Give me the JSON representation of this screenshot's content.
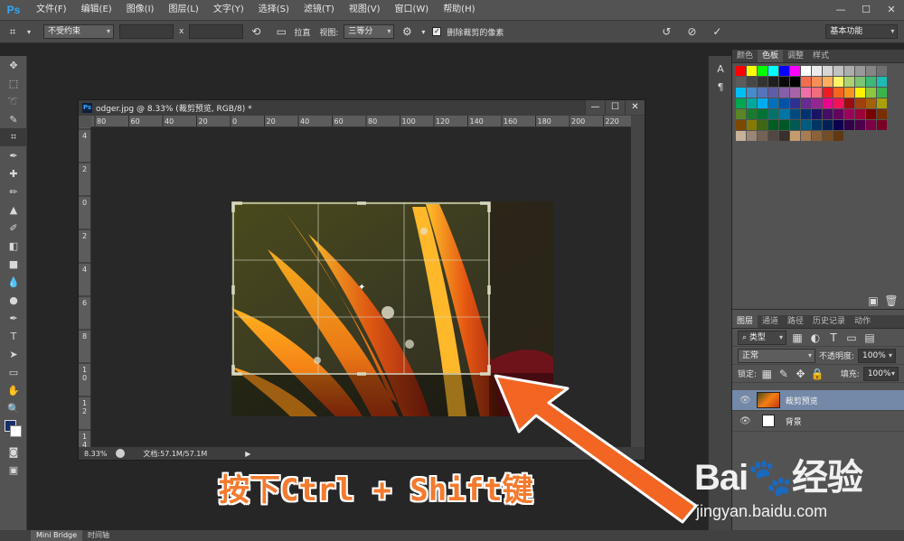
{
  "menubar": {
    "logo": "Ps",
    "items": [
      "文件(F)",
      "编辑(E)",
      "图像(I)",
      "图层(L)",
      "文字(Y)",
      "选择(S)",
      "滤镜(T)",
      "视图(V)",
      "窗口(W)",
      "帮助(H)"
    ],
    "window_buttons": [
      "—",
      "☐",
      "✕"
    ]
  },
  "options": {
    "ratio": "不受约束",
    "x_label": "x",
    "straighten": "拉直",
    "view_label": "视图:",
    "view_value": "三等分",
    "delete_pixels": "删除裁剪的像素",
    "workspace": "基本功能"
  },
  "doc": {
    "title": "odger.jpg @ 8.33% (裁剪预览, RGB/8) *",
    "ruler_top": [
      "80",
      "60",
      "40",
      "20",
      "0",
      "20",
      "40",
      "60",
      "80",
      "100",
      "120",
      "140",
      "160",
      "180",
      "200",
      "220"
    ],
    "ruler_left": [
      "4",
      "2",
      "0",
      "2",
      "4",
      "6",
      "8",
      "1 0",
      "1 2",
      "1 4"
    ],
    "zoom": "8.33%",
    "docsize": "文档:57.1M/57.1M"
  },
  "panels": {
    "swatch_tabs": [
      "颜色",
      "色板",
      "调整",
      "样式"
    ],
    "swatch_colors": [
      "#ff0000",
      "#ffff00",
      "#00ff00",
      "#00ffff",
      "#0000ff",
      "#ff00ff",
      "#ffffff",
      "#ebebeb",
      "#d6d6d6",
      "#c2c2c2",
      "#adadad",
      "#999999",
      "#858585",
      "#707070",
      "#5c5c5c",
      "#474747",
      "#333333",
      "#1f1f1f",
      "#0a0a0a",
      "#000000",
      "#f26c4f",
      "#f68e56",
      "#fbaf5c",
      "#fff467",
      "#acd372",
      "#7dc473",
      "#3cb878",
      "#1cbbb4",
      "#00bff3",
      "#448ccb",
      "#5574b9",
      "#605ca8",
      "#855fa8",
      "#a864a8",
      "#f06eaa",
      "#f26d7d",
      "#ed1c24",
      "#f26522",
      "#f7941d",
      "#fff200",
      "#8dc63f",
      "#39b54a",
      "#00a651",
      "#00a99d",
      "#00aeef",
      "#0072bc",
      "#0054a6",
      "#2e3192",
      "#662d91",
      "#92278f",
      "#ec008c",
      "#ed145b",
      "#9e0b0f",
      "#a0410d",
      "#a3620a",
      "#aba000",
      "#598527",
      "#197b30",
      "#007236",
      "#00746b",
      "#0076a3",
      "#004a80",
      "#003471",
      "#1b1464",
      "#440e62",
      "#630460",
      "#9e005d",
      "#9e0039",
      "#790000",
      "#7b2e00",
      "#7d4900",
      "#827b00",
      "#406618",
      "#005e20",
      "#005826",
      "#005952",
      "#005b7f",
      "#003663",
      "#002157",
      "#0d004c",
      "#32004b",
      "#4b0049",
      "#7b0046",
      "#7a0026",
      "#c7b299",
      "#998675",
      "#736357",
      "#534741",
      "#37302d",
      "#c69c6d",
      "#a67c52",
      "#8c6239",
      "#754c24",
      "#603913"
    ],
    "layer_tabs": [
      "图层",
      "通道",
      "路径",
      "历史记录",
      "动作"
    ],
    "kind": "类型",
    "blend_mode": "正常",
    "opacity_label": "不透明度:",
    "opacity_value": "100%",
    "lock_label": "锁定:",
    "fill_label": "填充:",
    "fill_value": "100%",
    "layers": [
      {
        "name": "裁剪预览",
        "selected": true
      },
      {
        "name": "背景",
        "selected": false
      }
    ]
  },
  "footer": {
    "tabs": [
      "Mini Bridge",
      "时间轴"
    ]
  },
  "caption": "按下Ctrl + Shift键",
  "watermark": {
    "big": "Bai🐾经验",
    "small": "jingyan.baidu.com"
  },
  "colors": {
    "foreground": "#1a2f6a",
    "background": "#ffffff",
    "caption": "#f47a2e",
    "arrow": "#f26522",
    "selected_layer": "#7489a8"
  }
}
